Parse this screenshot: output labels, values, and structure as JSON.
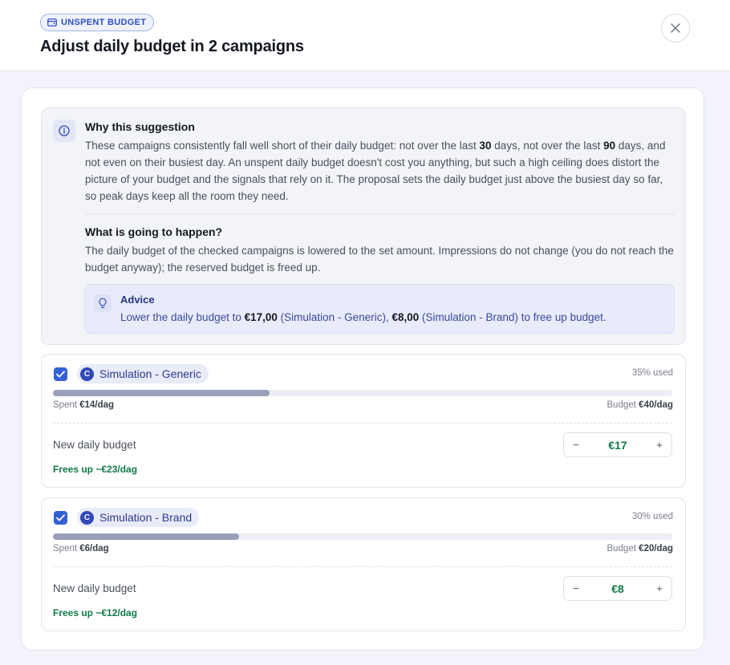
{
  "header": {
    "badge": "UNSPENT BUDGET",
    "title": "Adjust daily budget in 2 campaigns"
  },
  "info": {
    "title": "Why this suggestion",
    "why_part1": "These campaigns consistently fall well short of their daily budget: not over the last ",
    "days_short": "30",
    "why_part2": " days, not over the last ",
    "days_long": "90",
    "why_part3": " days, and not even on their busiest day. An unspent daily budget doesn't cost you anything, but such a high ceiling does distort the picture of your budget and the signals that rely on it. The proposal sets the daily budget just above the busiest day so far, so peak days keep all the room they need.",
    "happen_title": "What is going to happen?",
    "happen_text": "The daily budget of the checked campaigns is lowered to the set amount. Impressions do not change (you do not reach the budget anyway); the reserved budget is freed up."
  },
  "advice": {
    "title": "Advice",
    "part1": "Lower the daily budget to ",
    "amount1": "€17,00",
    "part2": " (Simulation - Generic), ",
    "amount2": "€8,00",
    "part3": " (Simulation - Brand) to free up budget."
  },
  "campaigns": [
    {
      "checked": true,
      "initial": "C",
      "name": "Simulation - Generic",
      "used": "35% used",
      "used_fraction": 0.35,
      "spent_label": "Spent ",
      "spent_value": "€14/dag",
      "budget_label": "Budget ",
      "budget_value": "€40/dag",
      "new_label": "New daily budget",
      "minus": "−",
      "new_value": "€17",
      "plus": "+",
      "frees": "Frees up ~€23/dag"
    },
    {
      "checked": true,
      "initial": "C",
      "name": "Simulation - Brand",
      "used": "30% used",
      "used_fraction": 0.3,
      "spent_label": "Spent ",
      "spent_value": "€6/dag",
      "budget_label": "Budget ",
      "budget_value": "€20/dag",
      "new_label": "New daily budget",
      "minus": "−",
      "new_value": "€8",
      "plus": "+",
      "frees": "Frees up ~€12/dag"
    }
  ],
  "colors": {
    "accent": "#3461d6",
    "positive": "#0f7a45",
    "bar_fill": "#97a0b8"
  },
  "icons": {
    "badge": "wallet-icon",
    "close": "close-icon",
    "info": "info-icon",
    "advice": "lightbulb-icon",
    "checkbox": "check-icon"
  }
}
